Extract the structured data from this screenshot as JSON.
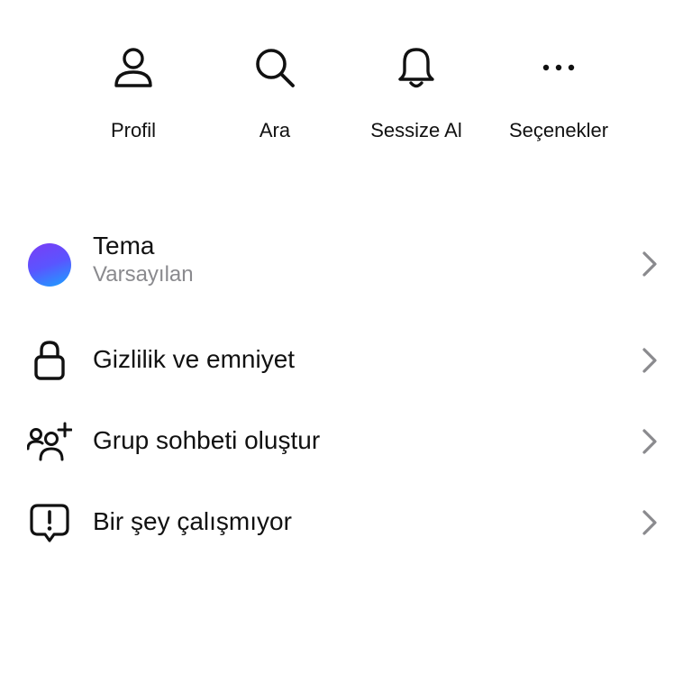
{
  "quick_actions": [
    {
      "label": "Profil",
      "icon": "person-icon"
    },
    {
      "label": "Ara",
      "icon": "search-icon"
    },
    {
      "label": "Sessize Al",
      "icon": "bell-icon"
    },
    {
      "label": "Seçenekler",
      "icon": "more-icon"
    }
  ],
  "menu": {
    "theme": {
      "title": "Tema",
      "subtitle": "Varsayılan",
      "icon": "theme-color-dot",
      "accent_colors": [
        "#7b3cf5",
        "#1aa3ff"
      ]
    },
    "privacy": {
      "title": "Gizlilik ve emniyet",
      "icon": "lock-icon"
    },
    "group_chat": {
      "title": "Grup sohbeti oluştur",
      "icon": "add-group-icon"
    },
    "report": {
      "title": "Bir şey çalışmıyor",
      "icon": "alert-bubble-icon"
    }
  },
  "colors": {
    "text": "#111111",
    "secondary_text": "#8a8a8e",
    "chevron": "#8a8a8e"
  }
}
